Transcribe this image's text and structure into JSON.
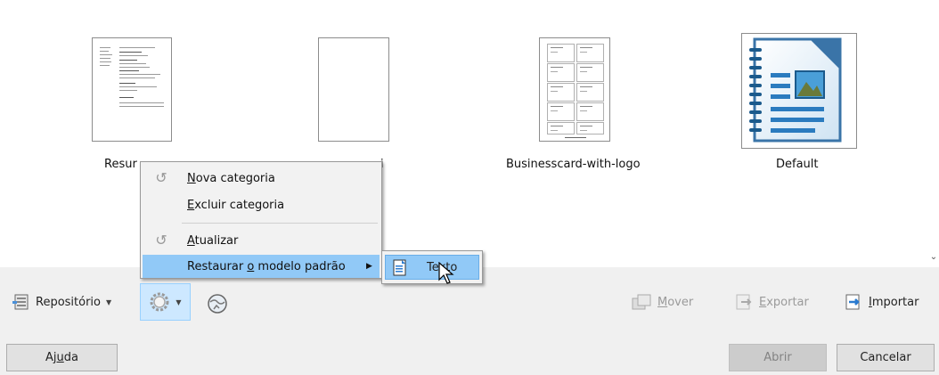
{
  "templates": [
    {
      "label": "Resur",
      "kind": "resume"
    },
    {
      "label": "",
      "kind": "blank"
    },
    {
      "label": "Businesscard-with-logo",
      "kind": "businesscard"
    },
    {
      "label": "Default",
      "kind": "default"
    }
  ],
  "second_label_fragment": "i",
  "toolbar": {
    "repository_label": "Repositório",
    "move_prefix": "",
    "move_mnemonic": "M",
    "move_rest": "over",
    "export_mnemonic": "E",
    "export_rest": "xportar",
    "import_mnemonic": "I",
    "import_rest": "mportar"
  },
  "context_menu": {
    "new_category_mnemonic": "N",
    "new_category_rest": "ova categoria",
    "delete_category_mnemonic": "E",
    "delete_category_rest": "xcluir categoria",
    "refresh_mnemonic": "A",
    "refresh_rest": "tualizar",
    "restore_prefix": "Restaurar ",
    "restore_mnemonic": "o",
    "restore_rest": " modelo padrão",
    "submenu_item_prefix": "Te",
    "submenu_item_mnemonic": "x",
    "submenu_item_rest": "to"
  },
  "buttons": {
    "help_prefix": "Aj",
    "help_mnemonic": "u",
    "help_rest": "da",
    "open": "Abrir",
    "cancel": "Cancelar"
  },
  "colors": {
    "highlight": "#91c9f7",
    "selected_toolbar": "#cde8ff"
  },
  "icons": {
    "menu_item": "refresh-icon",
    "submenu_item": "text-document-icon"
  }
}
